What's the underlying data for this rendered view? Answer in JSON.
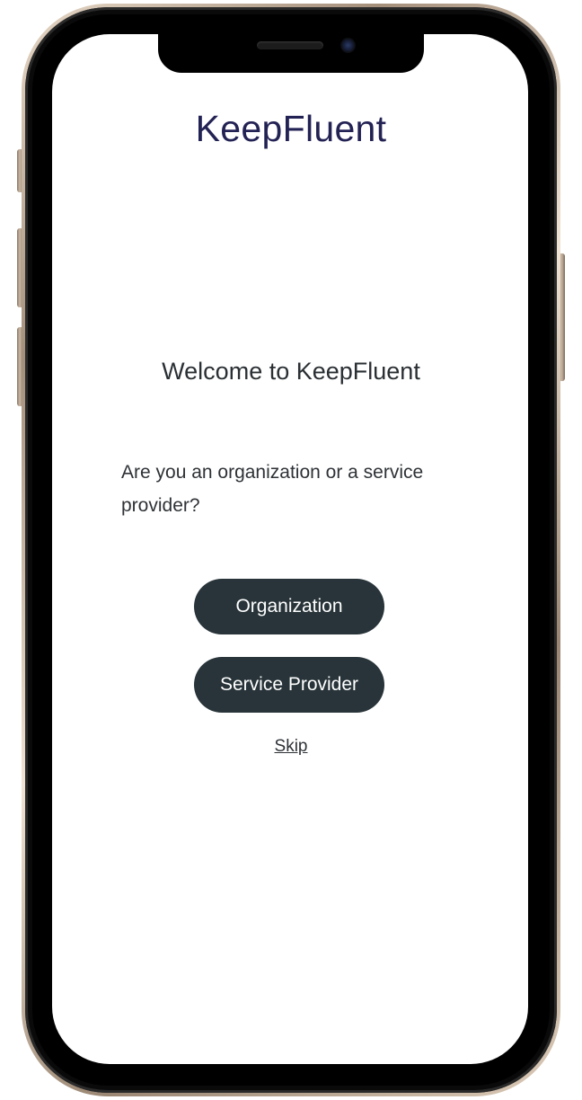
{
  "app": {
    "brand_name": "KeepFluent"
  },
  "onboarding": {
    "welcome_heading": "Welcome to KeepFluent",
    "question": "Are you an organization or a service provider?",
    "options": [
      {
        "label": "Organization"
      },
      {
        "label": "Service Provider"
      }
    ],
    "skip_label": "Skip"
  },
  "colors": {
    "brand_text": "#232254",
    "button_bg": "#283439",
    "button_text": "#ffffff",
    "body_text": "#2e3236",
    "screen_bg": "#ffffff"
  }
}
